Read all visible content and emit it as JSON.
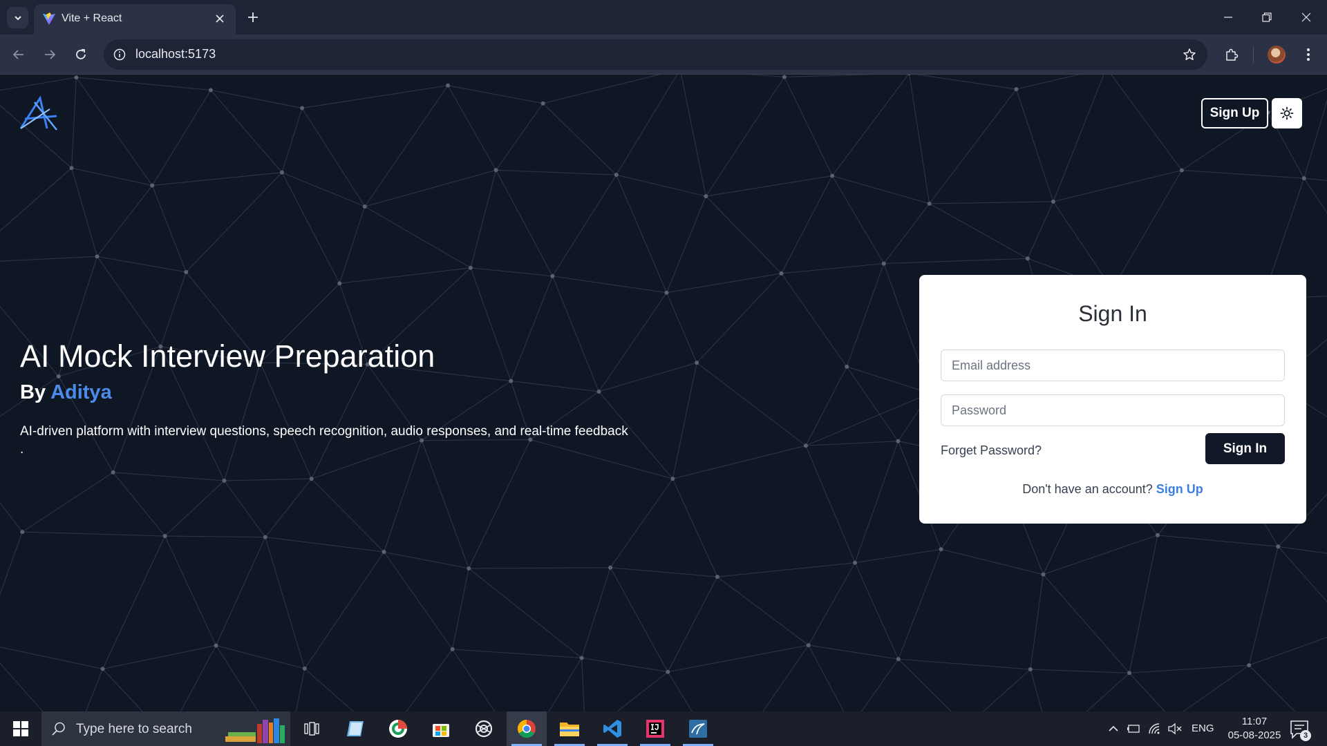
{
  "browser": {
    "tab_title": "Vite + React",
    "url": "localhost:5173"
  },
  "icons": {
    "tab_search": "chevron-down-icon",
    "favicon": "vite-logo-icon",
    "tab_close": "close-icon",
    "new_tab": "plus-icon",
    "back": "arrow-left-icon",
    "forward": "arrow-right-icon",
    "reload": "reload-icon",
    "site_info": "info-icon",
    "bookmark": "star-icon",
    "extensions": "puzzle-icon",
    "menu": "kebab-menu-icon",
    "theme": "sun-icon"
  },
  "header": {
    "signup_label": "Sign Up"
  },
  "hero": {
    "title": "AI Mock Interview Preparation",
    "by_prefix": "By",
    "author": "Aditya",
    "description": "AI-driven platform with interview questions, speech recognition, audio responses, and real-time feedback",
    "description_tail": "."
  },
  "signin": {
    "title": "Sign In",
    "email_placeholder": "Email address",
    "password_placeholder": "Password",
    "forgot_label": "Forget Password?",
    "button_label": "Sign In",
    "no_account_text": "Don't have an account?",
    "signup_link": "Sign Up"
  },
  "taskbar": {
    "search_placeholder": "Type here to search",
    "language": "ENG",
    "time": "11:07",
    "date": "05-08-2025",
    "notification_count": "3"
  },
  "colors": {
    "page_bg": "#0f1624",
    "accent_blue": "#4a8ce8",
    "card_bg": "#ffffff",
    "primary_button": "#111827"
  }
}
